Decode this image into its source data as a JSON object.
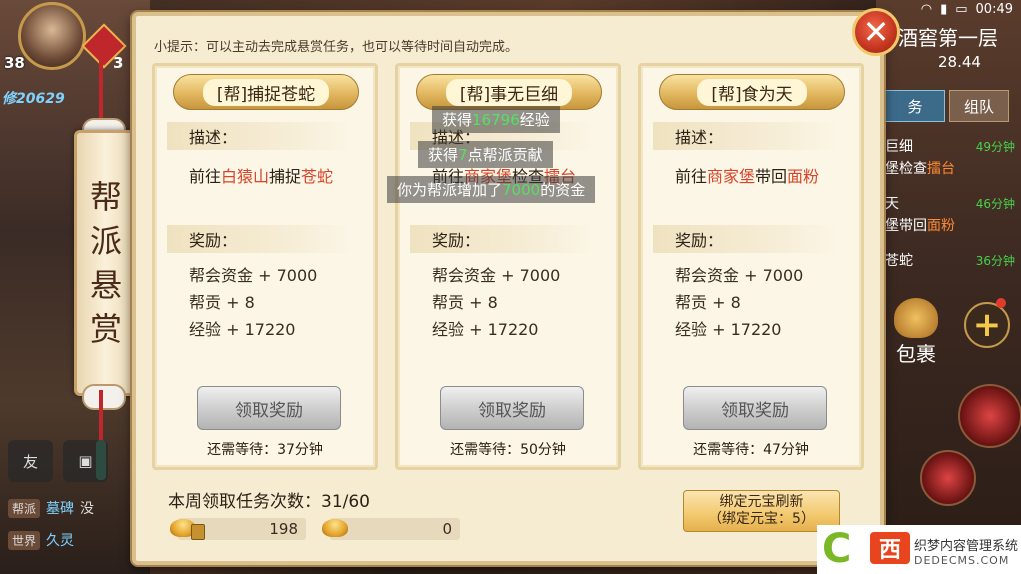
{
  "status_bar": {
    "time": "00:49"
  },
  "player": {
    "level": "38",
    "level_right": "3",
    "power_icon": "修",
    "power": "20629"
  },
  "banner": {
    "chars": [
      "帮",
      "派",
      "悬",
      "赏"
    ]
  },
  "left_panel": {
    "friend_label": "友",
    "chat": [
      {
        "channel": "帮派",
        "name": "墓碑",
        "text": "没"
      },
      {
        "channel": "世界",
        "name": "久灵",
        "text": ""
      }
    ]
  },
  "location": {
    "name": "酒窖第一层",
    "coord": "28.44"
  },
  "right_tabs": [
    {
      "label": "务",
      "active": true
    },
    {
      "label": "组队",
      "active": false
    }
  ],
  "task_list": [
    {
      "line1": "巨细",
      "line2_pre": "堡检查",
      "line2_hl": "擂台",
      "mins": "49分钟"
    },
    {
      "line1": "天",
      "line2_pre": "堡带回",
      "line2_hl": "面粉",
      "mins": "46分钟"
    },
    {
      "line1": "苍蛇",
      "line2_pre": "",
      "line2_hl": "",
      "mins": "36分钟"
    }
  ],
  "bag_label": "包裹",
  "dialog": {
    "tip": "小提示：可以主动去完成悬赏任务，也可以等待时间自动完成。",
    "close_symbol": "✕",
    "desc_label": "描述：",
    "reward_label": "奖励：",
    "claim_label": "领取奖励",
    "cards": [
      {
        "title": "[帮]捕捉苍蛇",
        "desc_pre": "前往",
        "desc_place": "白猿山",
        "desc_mid": "捕捉",
        "desc_target": "苍蛇",
        "rewards": [
          "帮会资金 + 7000",
          "帮贡 + 8",
          "经验 + 17220"
        ],
        "wait": "还需等待：37分钟"
      },
      {
        "title": "[帮]事无巨细",
        "desc_pre": "前往",
        "desc_place": "商家堡",
        "desc_mid": "检查",
        "desc_target": "擂台",
        "rewards": [
          "帮会资金 + 7000",
          "帮贡 + 8",
          "经验 + 17220"
        ],
        "wait": "还需等待：50分钟"
      },
      {
        "title": "[帮]食为天",
        "desc_pre": "前往",
        "desc_place": "商家堡",
        "desc_mid": "带回",
        "desc_target": "面粉",
        "rewards": [
          "帮会资金 + 7000",
          "帮贡 + 8",
          "经验 + 17220"
        ],
        "wait": "还需等待：47分钟"
      }
    ],
    "floating_msgs": [
      {
        "pre": "获得",
        "num": "16796",
        "post": "经验"
      },
      {
        "pre": "获得",
        "num": "7",
        "post": "点帮派贡献"
      },
      {
        "pre": "你为帮派增加了",
        "num": "7000",
        "post": "的资金"
      }
    ],
    "weekly": "本周领取任务次数：31/60",
    "currency": [
      {
        "value": "198"
      },
      {
        "value": "0"
      }
    ],
    "refresh_line1": "绑定元宝刷新",
    "refresh_line2": "（绑定元宝：5）"
  },
  "watermark": {
    "c": "C",
    "logo": "西",
    "line1": "织梦内容管理系统",
    "line2": "DEDECMS.COM"
  }
}
